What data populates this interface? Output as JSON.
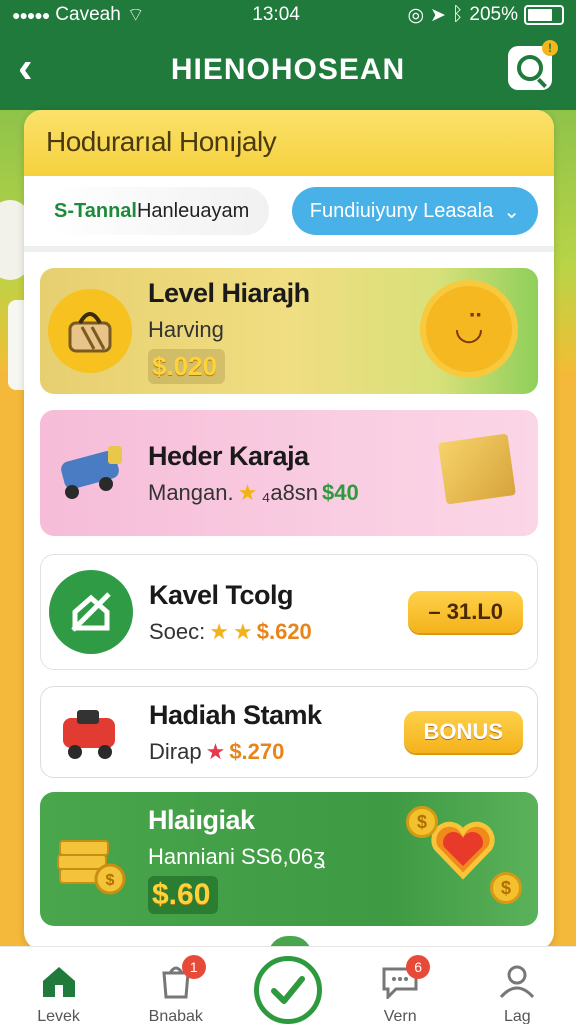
{
  "status_bar": {
    "carrier": "Caveah",
    "time": "13:04",
    "battery": "205%"
  },
  "app_bar": {
    "title": "HIENOHOSEAN"
  },
  "panel": {
    "title": "Hodurarıal Honıjaly",
    "filter_left": {
      "prefix": "S-Tannal",
      "text": "Hanleuayam"
    },
    "filter_right": "Fundiuiyuny Leasala"
  },
  "cards": [
    {
      "title": "Level Hiarajh",
      "subtitle": "Harving",
      "price": "$.020"
    },
    {
      "title": "Heder Karaja",
      "subtitle": "Mangan.",
      "value_orange": "₄a8sn",
      "value_green": "$40"
    },
    {
      "title": "Kavel Tcolg",
      "subtitle": "Soec:",
      "value": "$.620",
      "button": "– 31.L0"
    },
    {
      "title": "Hadiah Stamk",
      "subtitle": "Dirap",
      "value": "$.270",
      "button": "BONUS"
    },
    {
      "title": "Hlaiıgiak",
      "subtitle": "Hanniani SS6,06ʓ",
      "price": "$.60"
    }
  ],
  "bottom_nav": [
    {
      "label": "Levek",
      "badge": ""
    },
    {
      "label": "Bnabak",
      "badge": "1"
    },
    {
      "label": "Vern",
      "badge": "6"
    },
    {
      "label": "Lag",
      "badge": ""
    }
  ]
}
